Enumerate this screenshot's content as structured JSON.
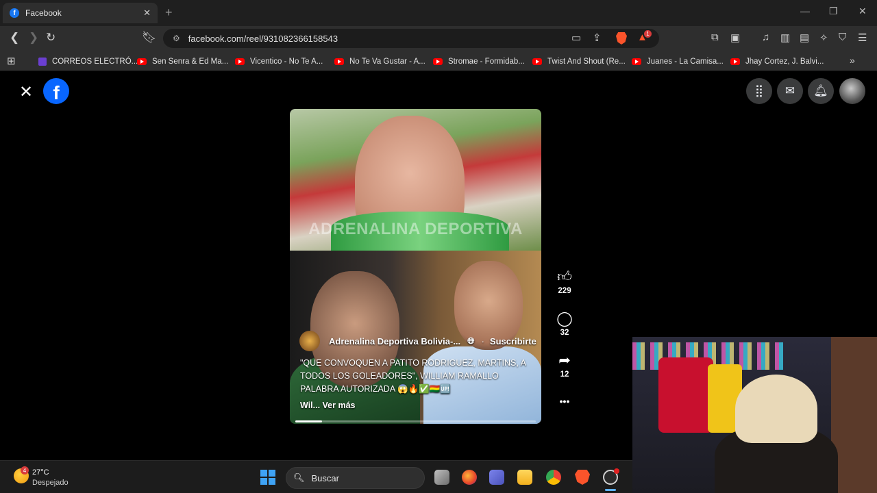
{
  "browser": {
    "tab_title": "Facebook",
    "tab_favicon": "f",
    "tab_close": "✕",
    "new_tab": "+",
    "url": "facebook.com/reel/931082366158543",
    "notif_count": "1",
    "window_controls": [
      "—",
      "❐",
      "✕"
    ]
  },
  "bookmarks": [
    {
      "label": "CORREOS ELECTRÓ...",
      "icon": "purple-doc-icon"
    },
    {
      "label": "Sen Senra & Ed Ma...",
      "icon": "youtube-icon"
    },
    {
      "label": "Vicentico - No Te A...",
      "icon": "youtube-icon"
    },
    {
      "label": "No Te Va Gustar - A...",
      "icon": "youtube-icon"
    },
    {
      "label": "Stromae - Formidab...",
      "icon": "youtube-icon"
    },
    {
      "label": "Twist And Shout (Re...",
      "icon": "youtube-icon"
    },
    {
      "label": "Juanes - La Camisa...",
      "icon": "youtube-icon"
    },
    {
      "label": "Jhay Cortez, J. Balvi...",
      "icon": "youtube-icon"
    }
  ],
  "facebook": {
    "logo": "f",
    "close": "✕"
  },
  "reel": {
    "watermark": "ADRENALINA DEPORTIVA",
    "channel_name": "Adrenalina Deportiva Bolivia-...",
    "separator": "·",
    "subscribe": "Suscribirte",
    "caption": "\"QUE CONVOQUEN A PATITO RODRIGUEZ, MARTINS, A TODOS LOS GOLEADORES\", WILLIAM RAMALLO PALABRA AUTORIZADA 😱🔥✅🇧🇴🆙",
    "more": "Wil... Ver más",
    "progress_fraction": 0.11,
    "likes": "229",
    "comments": "32",
    "shares": "12",
    "more_actions": "•••"
  },
  "taskbar": {
    "weather_temp": "27°C",
    "weather_desc": "Despejado",
    "weather_badge": "4",
    "search_placeholder": "Buscar"
  },
  "colors": {
    "facebook_blue": "#0866ff",
    "youtube_red": "#ff0000",
    "brave_orange": "#fb542b"
  }
}
